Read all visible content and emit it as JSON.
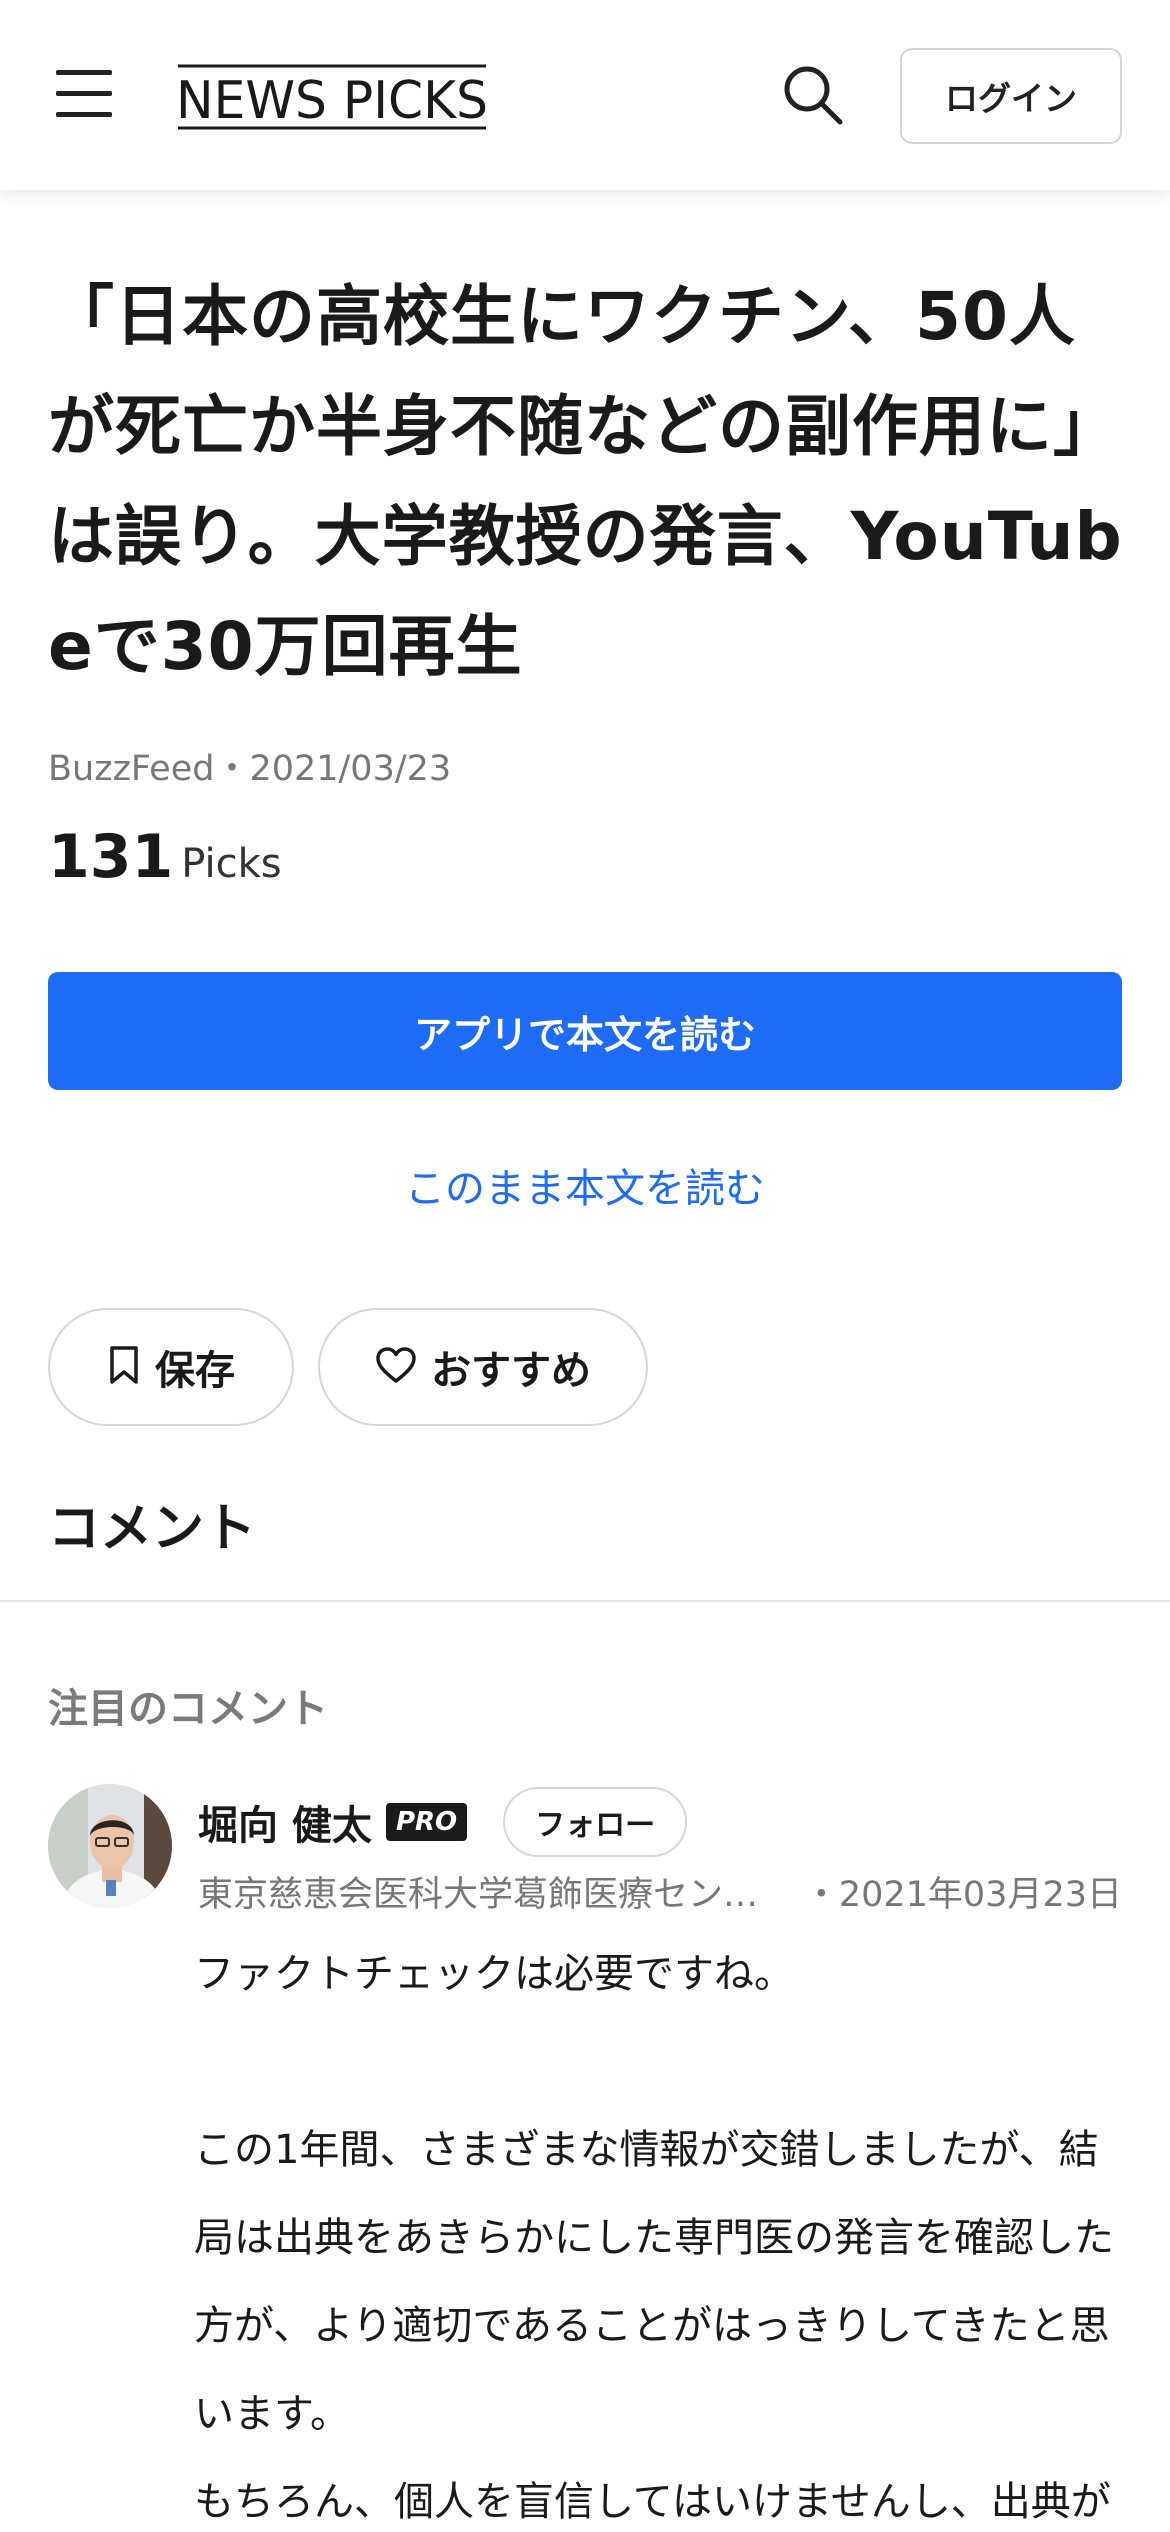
{
  "header": {
    "logo_text": "NEWS PICKS",
    "login_label": "ログイン"
  },
  "article": {
    "title": "「日本の高校生にワクチン、50人が死亡か半身不随などの副作用に」は誤り。大学教授の発言、YouTubeで30万回再生",
    "meta": "BuzzFeed・2021/03/23",
    "picks_count": "131",
    "picks_label": "Picks",
    "app_read_label": "アプリで本文を読む",
    "web_read_label": "このまま本文を読む",
    "save_label": "保存",
    "recommend_label": "おすすめ"
  },
  "comments": {
    "heading": "コメント",
    "featured_label": "注目のコメント",
    "items": [
      {
        "author": "堀向 健太",
        "badge": "PRO",
        "follow_label": "フォロー",
        "affiliation": "東京慈恵会医科大学葛飾医療センター",
        "date": "・2021年03月23日",
        "body": "ファクトチェックは必要ですね。\n\nこの1年間、さまざまな情報が交錯しましたが、結局は出典をあきらかにした専門医の発言を確認した方が、より適切であることがはっきりしてきたと思います。\nもちろん、個人を盲信してはいけませんし、出典があれば大丈夫というわけでもありませんけれど、"
      }
    ]
  },
  "colors": {
    "accent_blue": "#1e6bf5",
    "text_primary": "#1a1a1a",
    "text_secondary": "#777777"
  },
  "icons": [
    "menu-icon",
    "search-icon",
    "bookmark-icon",
    "heart-icon"
  ]
}
